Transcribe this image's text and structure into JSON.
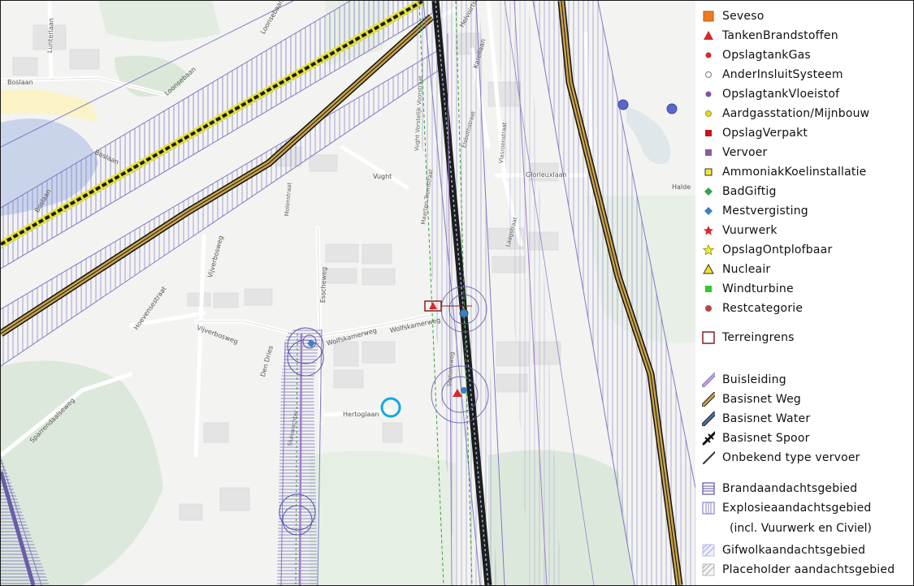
{
  "map": {
    "streets": {
      "loonsebaan_1": "Loonsebaan",
      "loonsebaan_2": "Loonsebaan",
      "lunterlaan": "Lunterlaan",
      "boslaan_1": "Boslaan",
      "boslaan_2": "Boslaan",
      "boslaan_3": "Boslaan",
      "helvoirtseweg": "Helvoirtseweg",
      "vught_vorstelijk": "Vught Vorstelijk Voorstraat",
      "karellaan": "Karellaan",
      "vlasroenstraat": "Vlasroenstraat",
      "elsbothstraat": "Elsbothstraat",
      "gloriexlaan": "Glorieuxlaan",
      "vught_label": "Vught",
      "maasstraat": "Maarten Tromstraat",
      "molenstraat": "Molenstraat",
      "laagstraat": "Laagstraat",
      "vijverbosweg_1": "Vijverbosweg",
      "vijverbosweg_2": "Vijverbosweg",
      "esscheweg": "Esscheweg",
      "hoevenseweg": "Hoevensestraat",
      "wolfskamerweg_1": "Wolfskamerweg",
      "wolfskamerweg_2": "Wolfskamerweg",
      "den_dries": "Den Dries",
      "sparrendaalseweg": "Sparrendaalseweg",
      "hertoglaan": "Hertoglaan",
      "halder": "Halde",
      "sluiswachter": "Sluiswachter",
      "stationsweg": "Stationsweg"
    },
    "colors": {
      "background": "#f3f3f1",
      "water": "#c9d4ea",
      "green": "#dde8dc",
      "road_fill": "#ffffff",
      "building": "#e2e2e2",
      "hatch": "#8a86c9",
      "pipeline": "#a27fc9",
      "buisleiding": "#a27fc9",
      "road_basisnet": "#c8a24a",
      "water_basisnet": "#4c6d9f",
      "rail": "#111111",
      "green_line": "#2fa52f",
      "yellow_line": "#e8e23a",
      "marker_circle": "#16a8e0",
      "terreingrens": "#8c1e1e",
      "tank_red": "#d42a2a"
    }
  },
  "legend": {
    "items": [
      {
        "label": "Seveso",
        "icon": "orange-square",
        "color": "#f07a1d"
      },
      {
        "label": "TankenBrandstoffen",
        "icon": "red-triangle",
        "color": "#d42a2a"
      },
      {
        "label": "OpslagtankGas",
        "icon": "red-dot",
        "color": "#d42a2a"
      },
      {
        "label": "AnderInsluitSysteem",
        "icon": "white-dot",
        "color": "#ffffff"
      },
      {
        "label": "OpslagtankVloeistof",
        "icon": "purple-dot",
        "color": "#8b4f9e"
      },
      {
        "label": "Aardgasstation/Mijnbouw",
        "icon": "yellow-dot",
        "color": "#e3d829"
      },
      {
        "label": "OpslagVerpakt",
        "icon": "darkred-square",
        "color": "#c41616"
      },
      {
        "label": "Vervoer",
        "icon": "purple-square",
        "color": "#8a5c9c"
      },
      {
        "label": "AmmoniakKoelinstallatie",
        "icon": "yellow-square",
        "color": "#f2e73a"
      },
      {
        "label": "BadGiftig",
        "icon": "green-diamond",
        "color": "#3e9e4c"
      },
      {
        "label": "Mestvergisting",
        "icon": "blue-diamond",
        "color": "#3f7fbf"
      },
      {
        "label": "Vuurwerk",
        "icon": "red-star",
        "color": "#e32222"
      },
      {
        "label": "OpslagOntplofbaar",
        "icon": "yellow-star",
        "color": "#f4ef32"
      },
      {
        "label": "Nucleair",
        "icon": "yellow-triangle",
        "color": "#f0e02a"
      },
      {
        "label": "Windturbine",
        "icon": "green-square",
        "color": "#2ec92e"
      },
      {
        "label": "Restcategorie",
        "icon": "brown-dot",
        "color": "#b04a4a"
      }
    ],
    "terreingrens": {
      "label": "Terreingrens",
      "icon": "outline-square",
      "color": "#8c1e1e"
    },
    "lines": [
      {
        "label": "Buisleiding",
        "icon": "buisleiding-line",
        "color": "#a27fc9"
      },
      {
        "label": "Basisnet Weg",
        "icon": "road-line",
        "color": "#c8a24a"
      },
      {
        "label": "Basisnet Water",
        "icon": "water-line",
        "color": "#4c6d9f"
      },
      {
        "label": "Basisnet Spoor",
        "icon": "rail-line",
        "color": "#111111"
      },
      {
        "label": "Onbekend type vervoer",
        "icon": "unknown-line",
        "color": "#333333"
      }
    ],
    "areas": [
      {
        "label": "Brandaandachtsgebied",
        "icon": "horizontal-hatch-box",
        "color": "#5a55a8"
      },
      {
        "label": "Explosieaandachtsgebied",
        "icon": "vertical-hatch-box",
        "color": "#8a86c9"
      },
      {
        "label": "(incl. Vuurwerk en Civiel)",
        "icon": "",
        "color": ""
      },
      {
        "label": "Gifwolkaandachtsgebied",
        "icon": "diagonal-hatch-box",
        "color": "#9fa3e0"
      },
      {
        "label": "Placeholder aandachtsgebied",
        "icon": "grey-hatch-box",
        "color": "#aaaaaa"
      }
    ]
  }
}
